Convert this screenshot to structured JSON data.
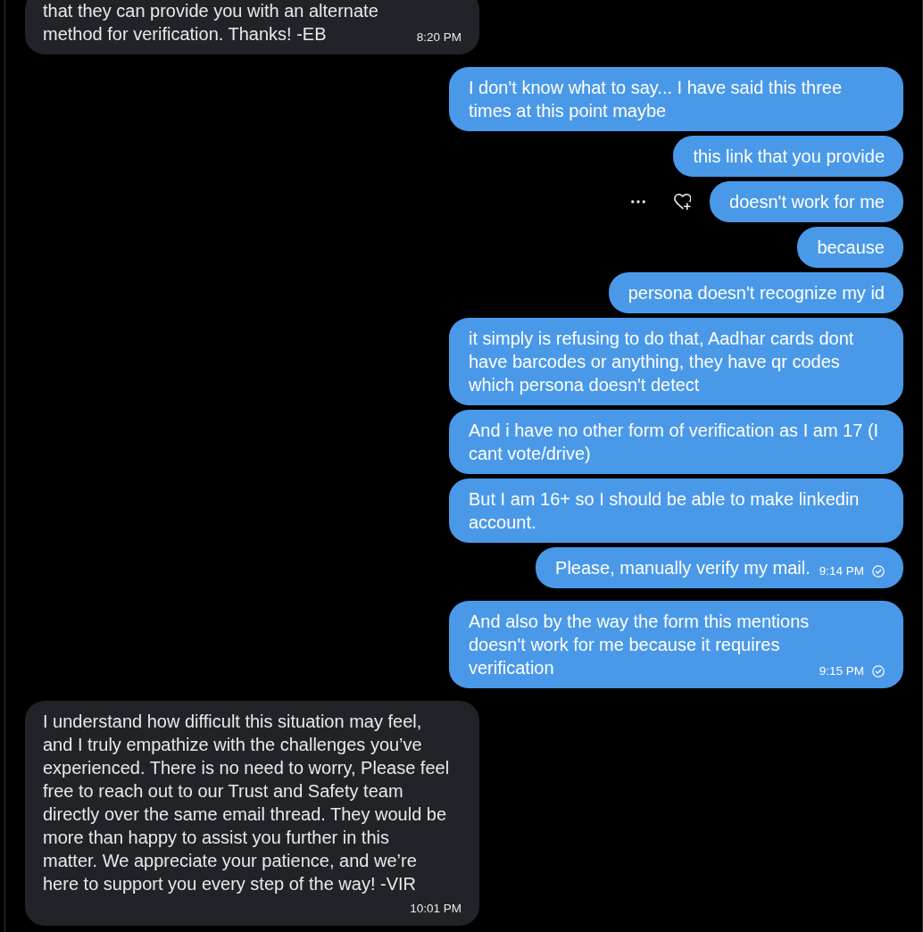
{
  "conversation": {
    "messages": [
      {
        "kind": "received",
        "text": "that they can provide you with an alternate\nmethod for verification. Thanks! -EB",
        "meta": {
          "time": "8:20 PM",
          "delivered": false
        },
        "hovered": false
      },
      {
        "kind": "sent",
        "text": "I don't know what to say... I have said this three\ntimes at this point maybe",
        "hovered": false
      },
      {
        "kind": "sent",
        "text": "this link that you provide",
        "hovered": false
      },
      {
        "kind": "sent",
        "text": "doesn't work for me",
        "hovered": true
      },
      {
        "kind": "sent",
        "text": "because",
        "hovered": false
      },
      {
        "kind": "sent",
        "text": "persona doesn't recognize my id",
        "hovered": false
      },
      {
        "kind": "sent",
        "text": "it simply is refusing to do that, Aadhar cards dont\nhave barcodes or anything, they have qr codes\nwhich persona doesn't detect",
        "hovered": false
      },
      {
        "kind": "sent",
        "text": "And i have no other form of verification as I am 17 (I\ncant vote/drive)",
        "hovered": false
      },
      {
        "kind": "sent",
        "text": "But I am 16+ so I should be able to make linkedin\naccount.",
        "hovered": false
      },
      {
        "kind": "sent",
        "text": "Please, manually verify my mail.",
        "meta": {
          "time": "9:14 PM",
          "delivered": true
        },
        "hovered": false
      },
      {
        "kind": "sent",
        "text": "And also by the way the form this mentions\ndoesn't work for me because it requires\nverification",
        "meta": {
          "time": "9:15 PM",
          "delivered": true
        },
        "hovered": false
      },
      {
        "kind": "received",
        "text": "I understand how difficult this situation may feel,\nand I truly empathize with the challenges you’ve\nexperienced. There is no need to worry, Please feel\nfree to reach out to our Trust and Safety team\ndirectly over the same email thread. They would be\nmore than happy to assist you further in this\nmatter. We appreciate your patience, and we’re\nhere to support you every step of the way! -VIR",
        "meta": {
          "time": "10:01 PM",
          "delivered": false
        },
        "hovered": false
      }
    ]
  }
}
